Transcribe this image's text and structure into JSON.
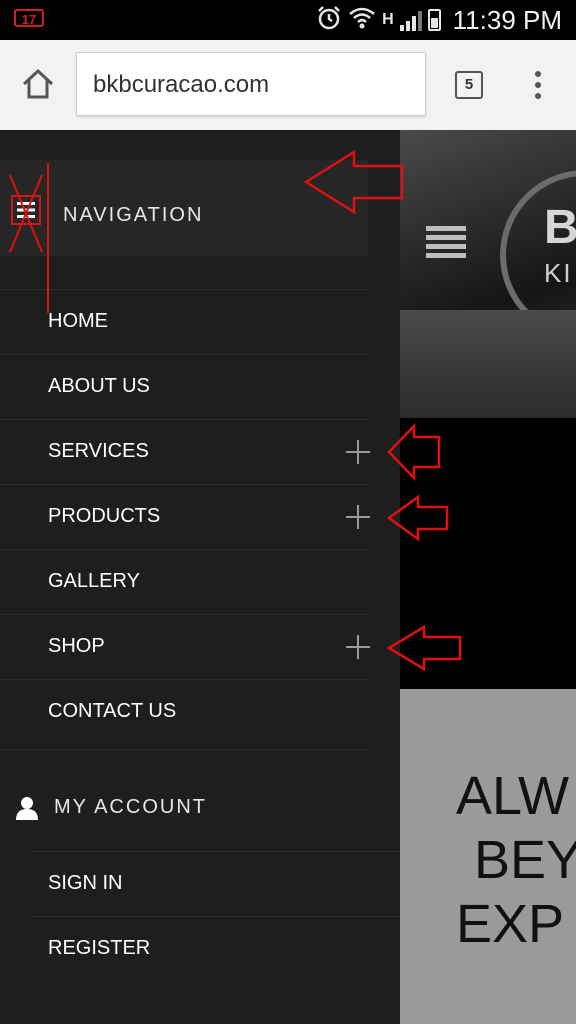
{
  "status_bar": {
    "notification_badge": "17",
    "time": "11:39 PM",
    "network_label": "H"
  },
  "browser": {
    "url": "bkbcuracao.com",
    "tab_count": "5"
  },
  "drawer": {
    "title": "NAVIGATION",
    "items": [
      {
        "label": "HOME",
        "expandable": false
      },
      {
        "label": "ABOUT US",
        "expandable": false
      },
      {
        "label": "SERVICES",
        "expandable": true
      },
      {
        "label": "PRODUCTS",
        "expandable": true
      },
      {
        "label": "GALLERY",
        "expandable": false
      },
      {
        "label": "SHOP",
        "expandable": true
      },
      {
        "label": "CONTACT US",
        "expandable": false
      }
    ],
    "account": {
      "title": "MY ACCOUNT",
      "items": [
        {
          "label": "SIGN IN"
        },
        {
          "label": "REGISTER"
        }
      ]
    }
  },
  "page": {
    "brand_partial": "B",
    "brand_sub_partial": "KI",
    "tagline_lines": [
      "ALW",
      "BEY",
      "EXP"
    ]
  },
  "colors": {
    "drawer_bg": "#1e1e1e",
    "annotation_red": "#e01010",
    "browser_bar": "#f2f2f2"
  }
}
